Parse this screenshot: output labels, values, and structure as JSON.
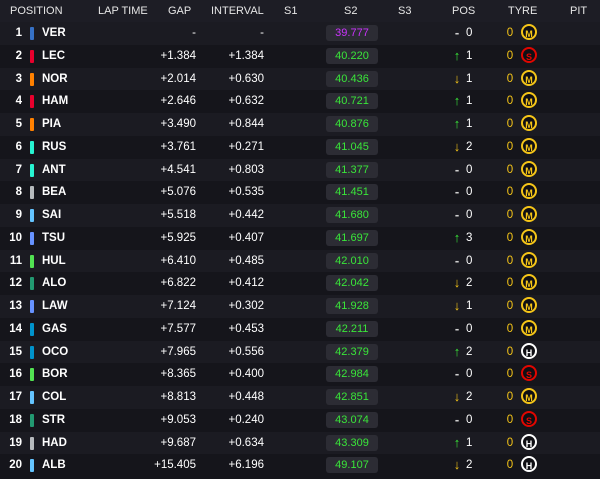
{
  "header": {
    "position": "POSITION",
    "lap_time": "LAP TIME",
    "gap": "GAP",
    "interval": "INTERVAL",
    "s1": "S1",
    "s2": "S2",
    "s3": "S3",
    "pos": "POS",
    "tyre": "TYRE",
    "pit": "PIT"
  },
  "colors": {
    "s2_purple": "#cc33ff",
    "s2_green": "#39e639",
    "arrow_up": "#39e639",
    "arrow_down": "#f5c518",
    "tyre_age": "#f5c518",
    "medium": "#f5c518",
    "soft": "#e10600",
    "hard": "#ffffff"
  },
  "rows": [
    {
      "pos": "1",
      "team_color": "#3671c6",
      "driver": "VER",
      "gap": "-",
      "interval": "-",
      "s2": "39.777",
      "s2_color": "purple",
      "arrow": "",
      "pos_change": "0",
      "tyre_age": "0",
      "tyre": "M"
    },
    {
      "pos": "2",
      "team_color": "#e8002d",
      "driver": "LEC",
      "gap": "+1.384",
      "interval": "+1.384",
      "s2": "40.220",
      "s2_color": "green",
      "arrow": "up",
      "pos_change": "1",
      "tyre_age": "0",
      "tyre": "S"
    },
    {
      "pos": "3",
      "team_color": "#ff8000",
      "driver": "NOR",
      "gap": "+2.014",
      "interval": "+0.630",
      "s2": "40.436",
      "s2_color": "green",
      "arrow": "down",
      "pos_change": "1",
      "tyre_age": "0",
      "tyre": "M"
    },
    {
      "pos": "4",
      "team_color": "#e8002d",
      "driver": "HAM",
      "gap": "+2.646",
      "interval": "+0.632",
      "s2": "40.721",
      "s2_color": "green",
      "arrow": "up",
      "pos_change": "1",
      "tyre_age": "0",
      "tyre": "M"
    },
    {
      "pos": "5",
      "team_color": "#ff8000",
      "driver": "PIA",
      "gap": "+3.490",
      "interval": "+0.844",
      "s2": "40.876",
      "s2_color": "green",
      "arrow": "up",
      "pos_change": "1",
      "tyre_age": "0",
      "tyre": "M"
    },
    {
      "pos": "6",
      "team_color": "#27f4d2",
      "driver": "RUS",
      "gap": "+3.761",
      "interval": "+0.271",
      "s2": "41.045",
      "s2_color": "green",
      "arrow": "down",
      "pos_change": "2",
      "tyre_age": "0",
      "tyre": "M"
    },
    {
      "pos": "7",
      "team_color": "#27f4d2",
      "driver": "ANT",
      "gap": "+4.541",
      "interval": "+0.803",
      "s2": "41.377",
      "s2_color": "green",
      "arrow": "",
      "pos_change": "0",
      "tyre_age": "0",
      "tyre": "M"
    },
    {
      "pos": "8",
      "team_color": "#b6babd",
      "driver": "BEA",
      "gap": "+5.076",
      "interval": "+0.535",
      "s2": "41.451",
      "s2_color": "green",
      "arrow": "",
      "pos_change": "0",
      "tyre_age": "0",
      "tyre": "M"
    },
    {
      "pos": "9",
      "team_color": "#64c4ff",
      "driver": "SAI",
      "gap": "+5.518",
      "interval": "+0.442",
      "s2": "41.680",
      "s2_color": "green",
      "arrow": "",
      "pos_change": "0",
      "tyre_age": "0",
      "tyre": "M"
    },
    {
      "pos": "10",
      "team_color": "#6692ff",
      "driver": "TSU",
      "gap": "+5.925",
      "interval": "+0.407",
      "s2": "41.697",
      "s2_color": "green",
      "arrow": "up",
      "pos_change": "3",
      "tyre_age": "0",
      "tyre": "M"
    },
    {
      "pos": "11",
      "team_color": "#52e252",
      "driver": "HUL",
      "gap": "+6.410",
      "interval": "+0.485",
      "s2": "42.010",
      "s2_color": "green",
      "arrow": "",
      "pos_change": "0",
      "tyre_age": "0",
      "tyre": "M"
    },
    {
      "pos": "12",
      "team_color": "#229971",
      "driver": "ALO",
      "gap": "+6.822",
      "interval": "+0.412",
      "s2": "42.042",
      "s2_color": "green",
      "arrow": "down",
      "pos_change": "2",
      "tyre_age": "0",
      "tyre": "M"
    },
    {
      "pos": "13",
      "team_color": "#6692ff",
      "driver": "LAW",
      "gap": "+7.124",
      "interval": "+0.302",
      "s2": "41.928",
      "s2_color": "green",
      "arrow": "down",
      "pos_change": "1",
      "tyre_age": "0",
      "tyre": "M"
    },
    {
      "pos": "14",
      "team_color": "#0093cc",
      "driver": "GAS",
      "gap": "+7.577",
      "interval": "+0.453",
      "s2": "42.211",
      "s2_color": "green",
      "arrow": "",
      "pos_change": "0",
      "tyre_age": "0",
      "tyre": "M"
    },
    {
      "pos": "15",
      "team_color": "#0093cc",
      "driver": "OCO",
      "gap": "+7.965",
      "interval": "+0.556",
      "s2": "42.379",
      "s2_color": "green",
      "arrow": "up",
      "pos_change": "2",
      "tyre_age": "0",
      "tyre": "H"
    },
    {
      "pos": "16",
      "team_color": "#52e252",
      "driver": "BOR",
      "gap": "+8.365",
      "interval": "+0.400",
      "s2": "42.984",
      "s2_color": "green",
      "arrow": "",
      "pos_change": "0",
      "tyre_age": "0",
      "tyre": "S"
    },
    {
      "pos": "17",
      "team_color": "#64c4ff",
      "driver": "COL",
      "gap": "+8.813",
      "interval": "+0.448",
      "s2": "42.851",
      "s2_color": "green",
      "arrow": "down",
      "pos_change": "2",
      "tyre_age": "0",
      "tyre": "M"
    },
    {
      "pos": "18",
      "team_color": "#229971",
      "driver": "STR",
      "gap": "+9.053",
      "interval": "+0.240",
      "s2": "43.074",
      "s2_color": "green",
      "arrow": "",
      "pos_change": "0",
      "tyre_age": "0",
      "tyre": "S"
    },
    {
      "pos": "19",
      "team_color": "#b6babd",
      "driver": "HAD",
      "gap": "+9.687",
      "interval": "+0.634",
      "s2": "43.309",
      "s2_color": "green",
      "arrow": "up",
      "pos_change": "1",
      "tyre_age": "0",
      "tyre": "H"
    },
    {
      "pos": "20",
      "team_color": "#64c4ff",
      "driver": "ALB",
      "gap": "+15.405",
      "interval": "+6.196",
      "s2": "49.107",
      "s2_color": "green",
      "arrow": "down",
      "pos_change": "2",
      "tyre_age": "0",
      "tyre": "H"
    }
  ]
}
